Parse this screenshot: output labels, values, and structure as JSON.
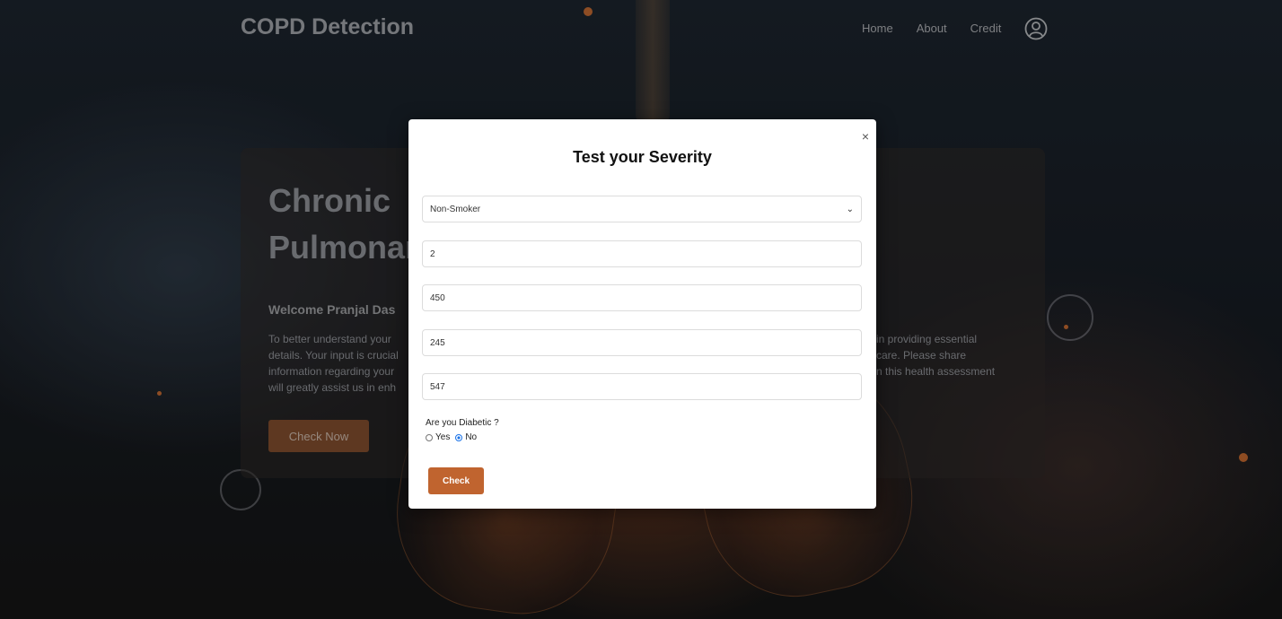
{
  "header": {
    "brand": "COPD Detection",
    "nav": [
      "Home",
      "About",
      "Credit"
    ]
  },
  "card": {
    "title_line1": "Chronic",
    "title_line2": "Pulmonary",
    "welcome": "Welcome Pranjal Das",
    "para_left": [
      "To better understand your",
      "details. Your input is crucial",
      "information regarding your",
      "will greatly assist us in enh"
    ],
    "para_right": [
      "in providing essential",
      "care. Please share",
      "n this health assessment",
      ""
    ],
    "cta": "Check Now"
  },
  "modal": {
    "title": "Test your Severity",
    "close_glyph": "×",
    "smoker_select": "Non-Smoker",
    "fields": [
      "2",
      "450",
      "245",
      "547"
    ],
    "diabetic_question": "Are you Diabetic ?",
    "options": [
      {
        "label": "Yes",
        "selected": false
      },
      {
        "label": "No",
        "selected": true
      }
    ],
    "submit": "Check"
  },
  "colors": {
    "accent": "#c0642f",
    "radio_selected": "#1a73e8"
  }
}
